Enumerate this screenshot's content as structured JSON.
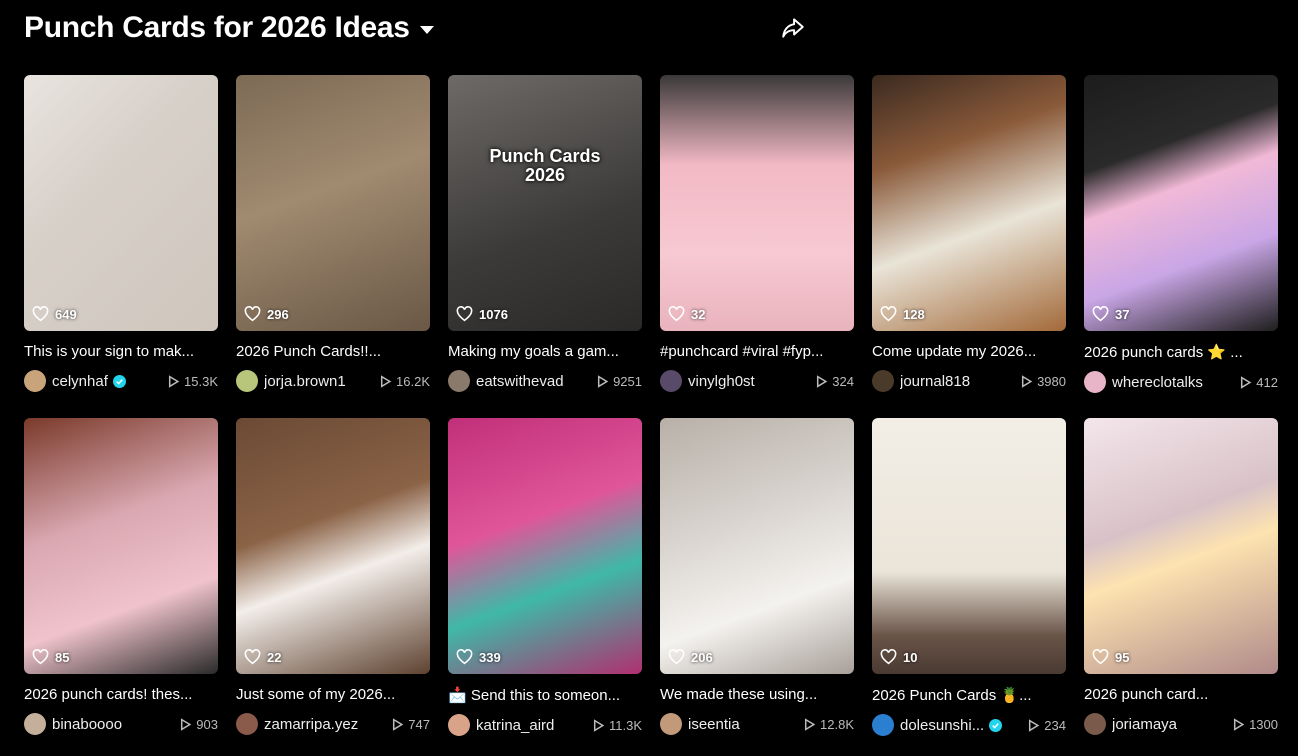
{
  "header": {
    "title": "Punch Cards for 2026 Ideas"
  },
  "colors": {
    "background": "#000000",
    "verified": "#20d5ec"
  },
  "videos": [
    {
      "caption": "This is your sign to mak...",
      "user": "celynhaf",
      "verified": true,
      "likes": "649",
      "views": "15.3K",
      "overlay": "",
      "bg": "linear-gradient(135deg,#e9e4df 0%,#d7d0c9 40%,#cfc6bd 100%)",
      "avatar": "#c9a47a"
    },
    {
      "caption": "2026 Punch Cards!!...",
      "user": "jorja.brown1",
      "verified": false,
      "likes": "296",
      "views": "16.2K",
      "overlay": "",
      "bg": "linear-gradient(160deg,#7d6a55 0%,#a08a70 45%,#6a5846 100%)",
      "avatar": "#b7c67a"
    },
    {
      "caption": "Making my goals a gam...",
      "user": "eatswithevad",
      "verified": false,
      "likes": "1076",
      "views": "9251",
      "overlay": "Punch Cards\n2026",
      "bg": "linear-gradient(160deg,#6d6a67 0%,#3c3a39 60%,#2a2928 100%)",
      "avatar": "#8a7a6b"
    },
    {
      "caption": "#punchcard #viral #fyp...",
      "user": "vinylgh0st",
      "verified": false,
      "likes": "32",
      "views": "324",
      "overlay": "",
      "bg": "linear-gradient(180deg,#3a3838 0%,#f2b9c4 35%,#f7c9d2 70%,#e9b3bd 100%)",
      "avatar": "#5a4a6a"
    },
    {
      "caption": "Come update my 2026...",
      "user": "journal818",
      "verified": false,
      "likes": "128",
      "views": "3980",
      "overlay": "",
      "bg": "linear-gradient(160deg,#3b2a20 0%,#8a5a3a 30%,#e9e4d8 60%,#a36a3a 100%)",
      "avatar": "#4a3a2a"
    },
    {
      "caption": "2026 punch cards ⭐ ...",
      "user": "whereclotalks",
      "verified": false,
      "likes": "37",
      "views": "412",
      "overlay": "",
      "bg": "linear-gradient(160deg,#1c1c1c 0%,#2a2a2a 30%,#f1b9d7 45%,#c9a6e6 70%,#1e1e1e 100%)",
      "avatar": "#e8b4c8"
    },
    {
      "caption": "2026 punch cards! thes...",
      "user": "binaboooo",
      "verified": false,
      "likes": "85",
      "views": "903",
      "overlay": "",
      "bg": "linear-gradient(160deg,#7a3a2a 0%,#d9a7b0 40%,#f0c3cc 70%,#2a2a2a 100%)",
      "avatar": "#c4b09a"
    },
    {
      "caption": "Just some of my 2026...",
      "user": "zamarripa.yez",
      "verified": false,
      "likes": "22",
      "views": "747",
      "overlay": "",
      "bg": "linear-gradient(160deg,#6b4a35 0%,#8a6246 40%,#f3eeea 60%,#5e4230 100%)",
      "avatar": "#8a5a4a"
    },
    {
      "caption": "📩 Send this to someon...",
      "user": "katrina_aird",
      "verified": false,
      "likes": "339",
      "views": "11.3K",
      "overlay": "",
      "bg": "linear-gradient(160deg,#c0307a 0%,#e0559a 40%,#3fb8a8 65%,#b03070 100%)",
      "avatar": "#d9a38a"
    },
    {
      "caption": "We made these using...",
      "user": "iseentia",
      "verified": false,
      "likes": "206",
      "views": "12.8K",
      "overlay": "",
      "bg": "linear-gradient(160deg,#b8b0a8 0%,#d9d4cf 40%,#f4f2ef 70%,#a8a099 100%)",
      "avatar": "#c29a7a"
    },
    {
      "caption": "2026 Punch Cards 🍍...",
      "user": "dolesunshi...",
      "verified": true,
      "likes": "10",
      "views": "234",
      "overlay": "",
      "bg": "linear-gradient(180deg,#f2eee6 0%,#ebe5d9 60%,#6a5448 85%,#4a3a32 100%)",
      "avatar": "#2a7fd1"
    },
    {
      "caption": "2026 punch card...",
      "user": "joriamaya",
      "verified": false,
      "likes": "95",
      "views": "1300",
      "overlay": "",
      "bg": "linear-gradient(160deg,#f3e6ea 0%,#d8c2c8 40%,#fde3b0 55%,#b08a8a 100%)",
      "avatar": "#7a5a4a"
    }
  ]
}
